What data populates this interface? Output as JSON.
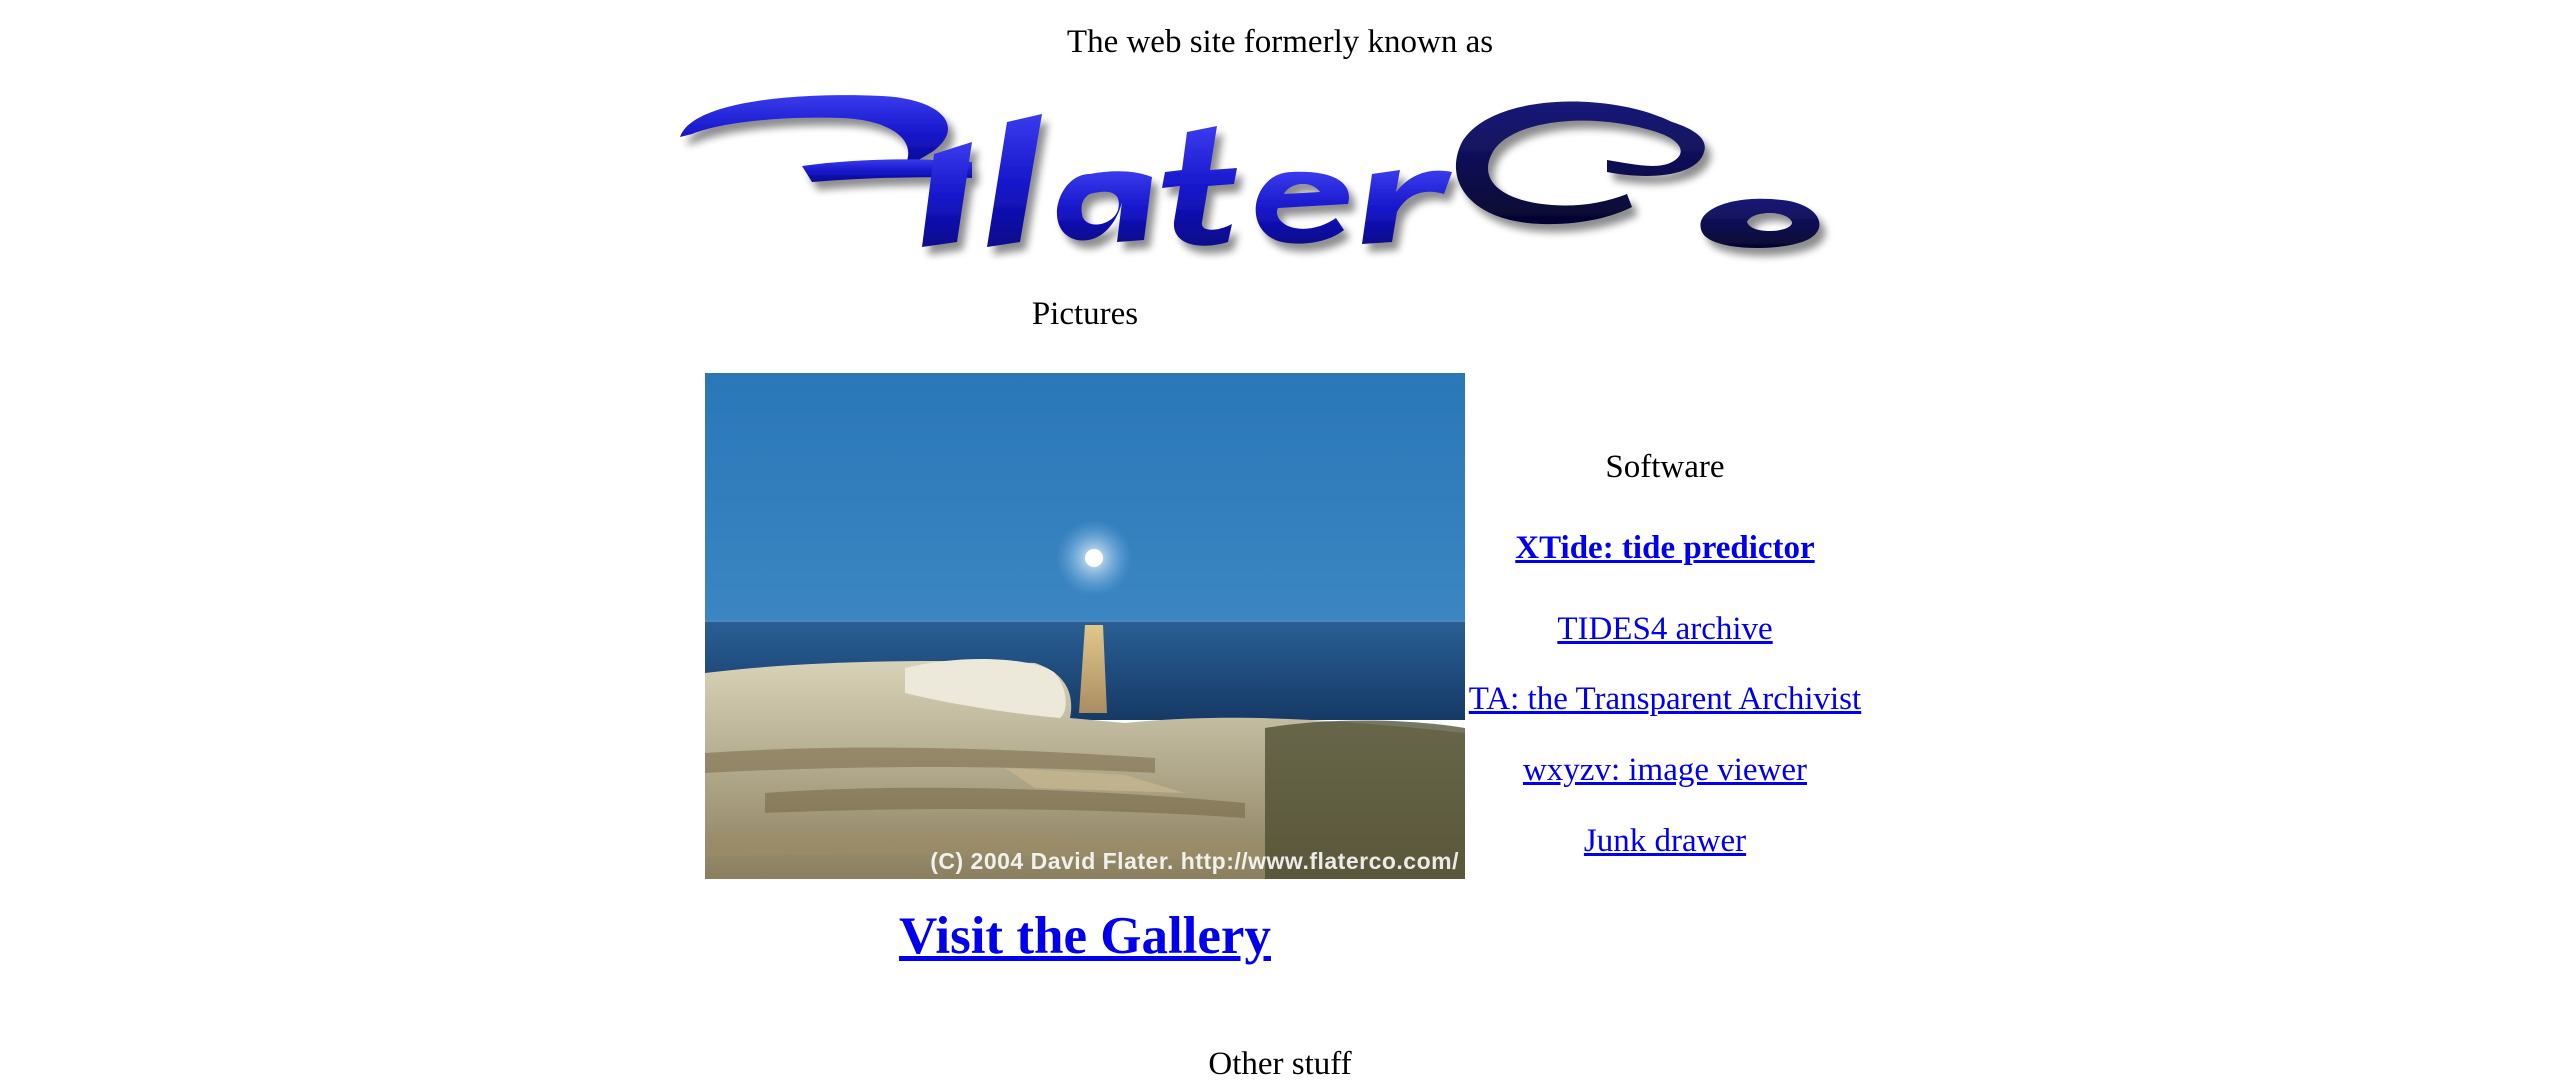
{
  "header": {
    "formerly_text": "The web site formerly known as",
    "logo_text": "FlaterCo"
  },
  "pictures": {
    "title": "Pictures",
    "photo_caption": "(C) 2004 David Flater.  http://www.flaterco.com/",
    "gallery_link": "Visit the Gallery"
  },
  "software": {
    "title": "Software",
    "links": [
      "XTide: tide predictor",
      "TIDES4 archive",
      "TA: the Transparent Archivist",
      "wxyzv: image viewer",
      "Junk drawer"
    ]
  },
  "other": {
    "title": "Other stuff"
  },
  "colors": {
    "link": "#0000ee",
    "logo_blue": "#1515c8",
    "logo_navy": "#0a0a55",
    "sky": "#2f7fbd",
    "sea": "#1f4f86"
  }
}
